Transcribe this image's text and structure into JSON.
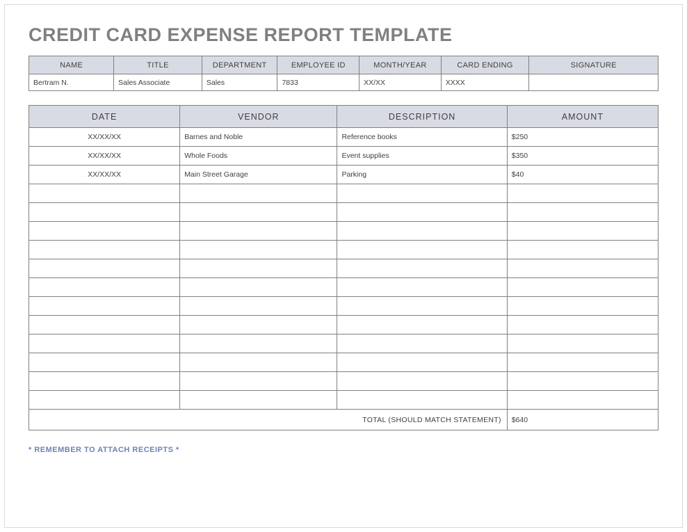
{
  "title": "CREDIT CARD EXPENSE REPORT TEMPLATE",
  "info": {
    "headers": {
      "name": "NAME",
      "title": "TITLE",
      "department": "DEPARTMENT",
      "employee_id": "EMPLOYEE ID",
      "month_year": "MONTH/YEAR",
      "card_ending": "CARD ENDING",
      "signature": "SIGNATURE"
    },
    "values": {
      "name": "Bertram N.",
      "title": "Sales Associate",
      "department": "Sales",
      "employee_id": "7833",
      "month_year": "XX/XX",
      "card_ending": "XXXX",
      "signature": ""
    }
  },
  "expense": {
    "headers": {
      "date": "DATE",
      "vendor": "VENDOR",
      "description": "DESCRIPTION",
      "amount": "AMOUNT"
    },
    "rows": [
      {
        "date": "XX/XX/XX",
        "vendor": "Barnes and Noble",
        "description": "Reference books",
        "amount": "$250"
      },
      {
        "date": "XX/XX/XX",
        "vendor": "Whole Foods",
        "description": "Event supplies",
        "amount": "$350"
      },
      {
        "date": "XX/XX/XX",
        "vendor": "Main Street Garage",
        "description": "Parking",
        "amount": "$40"
      },
      {
        "date": "",
        "vendor": "",
        "description": "",
        "amount": ""
      },
      {
        "date": "",
        "vendor": "",
        "description": "",
        "amount": ""
      },
      {
        "date": "",
        "vendor": "",
        "description": "",
        "amount": ""
      },
      {
        "date": "",
        "vendor": "",
        "description": "",
        "amount": ""
      },
      {
        "date": "",
        "vendor": "",
        "description": "",
        "amount": ""
      },
      {
        "date": "",
        "vendor": "",
        "description": "",
        "amount": ""
      },
      {
        "date": "",
        "vendor": "",
        "description": "",
        "amount": ""
      },
      {
        "date": "",
        "vendor": "",
        "description": "",
        "amount": ""
      },
      {
        "date": "",
        "vendor": "",
        "description": "",
        "amount": ""
      },
      {
        "date": "",
        "vendor": "",
        "description": "",
        "amount": ""
      },
      {
        "date": "",
        "vendor": "",
        "description": "",
        "amount": ""
      },
      {
        "date": "",
        "vendor": "",
        "description": "",
        "amount": ""
      }
    ],
    "total_label": "TOTAL (SHOULD MATCH STATEMENT)",
    "total_value": "$640"
  },
  "footer_note": "* REMEMBER TO ATTACH RECEIPTS *"
}
